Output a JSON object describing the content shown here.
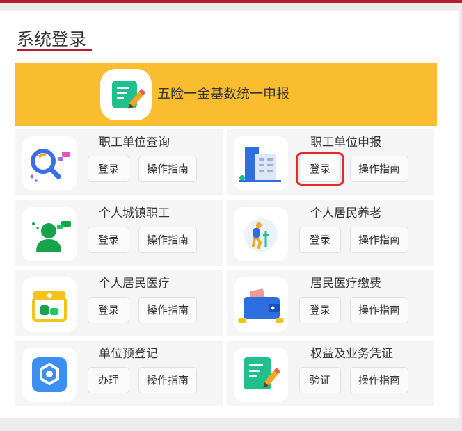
{
  "section": {
    "title": "系统登录"
  },
  "banner": {
    "title": "五险一金基数统一申报",
    "icon": "edit-document-icon"
  },
  "colors": {
    "accent": "#b81d2f",
    "banner": "#f9bd2f",
    "highlight": "#e62828"
  },
  "cards": [
    {
      "title": "职工单位查询",
      "login_label": "登录",
      "guide_label": "操作指南",
      "icon": "magnifier-chart-icon"
    },
    {
      "title": "职工单位申报",
      "login_label": "登录",
      "guide_label": "操作指南",
      "icon": "office-building-icon",
      "highlighted": true
    },
    {
      "title": "个人城镇职工",
      "login_label": "登录",
      "guide_label": "操作指南",
      "icon": "person-chat-icon"
    },
    {
      "title": "个人居民养老",
      "login_label": "登录",
      "guide_label": "操作指南",
      "icon": "elderly-person-icon"
    },
    {
      "title": "个人居民医疗",
      "login_label": "登录",
      "guide_label": "操作指南",
      "icon": "medical-kit-icon"
    },
    {
      "title": "居民医疗缴费",
      "login_label": "登录",
      "guide_label": "操作指南",
      "icon": "wallet-icon"
    },
    {
      "title": "单位预登记",
      "login_label": "办理",
      "guide_label": "操作指南",
      "icon": "gear-badge-icon"
    },
    {
      "title": "权益及业务凭证",
      "login_label": "验证",
      "guide_label": "操作指南",
      "icon": "certificate-icon"
    }
  ]
}
